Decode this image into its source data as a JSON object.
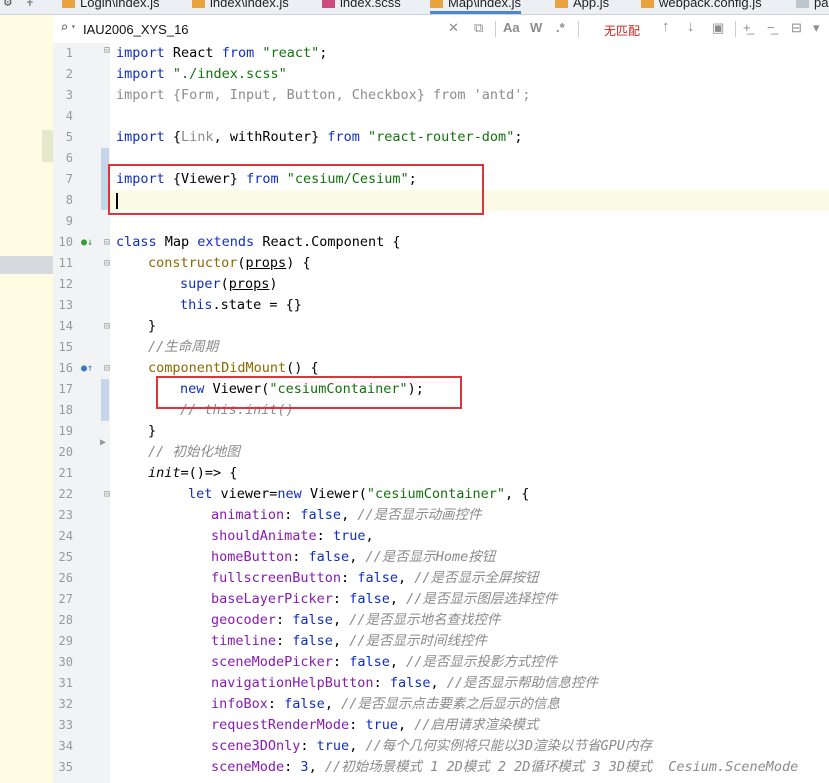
{
  "tabs": [
    {
      "label": "Login\\index.js",
      "type": "js",
      "active": false
    },
    {
      "label": "index\\index.js",
      "type": "js",
      "active": false
    },
    {
      "label": "index.scss",
      "type": "sass",
      "active": false
    },
    {
      "label": "Map\\index.js",
      "type": "js",
      "active": true
    },
    {
      "label": "App.js",
      "type": "js",
      "active": false
    },
    {
      "label": "webpack.config.js",
      "type": "js",
      "active": false
    },
    {
      "label": "pa",
      "type": "plain",
      "active": false
    }
  ],
  "find_bar": {
    "query": "IAU2006_XYS_16",
    "match_case_label": "Aa",
    "words_label": "W",
    "regex_label": ".*",
    "no_match_text": "无匹配"
  },
  "icons": {
    "settings": "gear-icon",
    "search": "search-icon",
    "clear": "close-icon",
    "history": "history-icon",
    "prev": "arrow-up-icon",
    "next": "arrow-down-icon",
    "select_all": "select-all-icon",
    "add_selection": "add-selection-icon",
    "remove_selection": "remove-selection-icon",
    "colors": {
      "keyword": "#0f2ec0",
      "string": "#13710d",
      "comment": "#8a8a8a",
      "function": "#8c6a00",
      "property": "#861bb3",
      "highlight_box": "#e0333a"
    }
  },
  "line_numbers": [
    "1",
    "2",
    "3",
    "4",
    "5",
    "6",
    "7",
    "8",
    "9",
    "10",
    "11",
    "12",
    "13",
    "14",
    "15",
    "16",
    "17",
    "18",
    "19",
    "20",
    "21",
    "22",
    "23",
    "24",
    "25",
    "26",
    "27",
    "28",
    "29",
    "30",
    "31",
    "32",
    "33",
    "34",
    "35"
  ],
  "code": {
    "l1": {
      "kw": "import",
      "a": " React ",
      "kw2": "from",
      "str": " \"react\"",
      "end": ";"
    },
    "l2": {
      "kw": "import",
      "str": " \"./index.scss\""
    },
    "l3": {
      "text": "import {Form, Input, Button, Checkbox} from 'antd';"
    },
    "l5": {
      "kw": "import",
      "a": " {",
      "b": "Link",
      "c": ", ",
      "d": "withRouter",
      "e": "} ",
      "kw2": "from",
      "str": " \"react-router-dom\"",
      "end": ";"
    },
    "l7": {
      "kw": "import",
      "a": " {Viewer} ",
      "kw2": "from",
      "str": " \"cesium/Cesium\"",
      "end": ";"
    },
    "l10": {
      "kw": "class",
      "a": " Map ",
      "kw2": "extends",
      "b": " React.Component {"
    },
    "l11": {
      "fn": "constructor",
      "a": "(",
      "p": "props",
      "b": ") {"
    },
    "l12": {
      "kw": "super",
      "a": "(",
      "p": "props",
      "b": ")"
    },
    "l13": {
      "kw": "this",
      "a": ".state = {}"
    },
    "l14": {
      "a": "}"
    },
    "l15": {
      "com": "//生命周期"
    },
    "l16": {
      "fn": "componentDidMount",
      "a": "() {"
    },
    "l17": {
      "kw": "new",
      "a": " Viewer(",
      "str": "\"cesiumContainer\"",
      "b": ");"
    },
    "l18": {
      "com": "// this.init()"
    },
    "l19": {
      "a": "}"
    },
    "l20": {
      "com": "// 初始化地图"
    },
    "l21": {
      "fn": "init",
      "a": "=()=> {"
    },
    "l22": {
      "kw": "let",
      "a": " viewer=",
      "kw2": "new",
      "b": " Viewer(",
      "str": "\"cesiumContainer\"",
      "c": ", {"
    },
    "props": [
      {
        "key": "animation",
        "val": "false",
        "com": "//是否显示动画控件"
      },
      {
        "key": "shouldAnimate",
        "val": "true",
        "com": ""
      },
      {
        "key": "homeButton",
        "val": "false",
        "com": "//是否显示Home按钮"
      },
      {
        "key": "fullscreenButton",
        "val": "false",
        "com": "//是否显示全屏按钮"
      },
      {
        "key": "baseLayerPicker",
        "val": "false",
        "com": "//是否显示图层选择控件"
      },
      {
        "key": "geocoder",
        "val": "false",
        "com": "//是否显示地名查找控件"
      },
      {
        "key": "timeline",
        "val": "false",
        "com": "//是否显示时间线控件"
      },
      {
        "key": "sceneModePicker",
        "val": "false",
        "com": "//是否显示投影方式控件"
      },
      {
        "key": "navigationHelpButton",
        "val": "false",
        "com": "//是否显示帮助信息控件"
      },
      {
        "key": "infoBox",
        "val": "false",
        "com": "//是否显示点击要素之后显示的信息"
      },
      {
        "key": "requestRenderMode",
        "val": "true",
        "com": "//启用请求渲染模式"
      },
      {
        "key": "scene3DOnly",
        "val": "true",
        "com": "//每个几何实例将只能以3D渲染以节省GPU内存"
      },
      {
        "key": "sceneMode",
        "val": "3",
        "com": "//初始场景模式 1 2D模式 2 2D循环模式 3 3D模式  Cesium.SceneMode"
      }
    ]
  }
}
